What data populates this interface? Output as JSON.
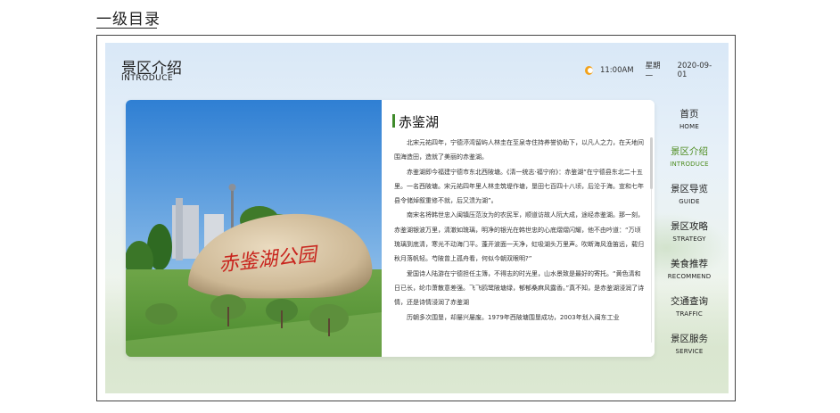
{
  "page_label": "一级目录",
  "header": {
    "title": "景区介绍",
    "subtitle": "INTRODUCE",
    "weather_icon": "sun-icon",
    "time": "11:00AM",
    "weekday": "星期一",
    "date": "2020-09-01"
  },
  "article": {
    "title": "赤鉴湖",
    "paragraphs": [
      "北宋元祐四年，宁德渟湾留屿人林圭在至泉寺住持养誉协助下，以凡人之力，在天地间围海造田，造就了美丽的赤鉴湖。",
      "赤鉴湖即今福建宁德市东北西陂塘。《清一统志·福宁府》：赤鉴湖“在宁德县东北二十五里。一名西陂塘。宋元祐四年里人林圭筑堤作塘，垦田七百四十八顷，后沦于海。宣和七年县令储焯叙重修不就，后又溃为湖”。",
      "南宋名将韩世忠入闽镇压范汝为的农民军，顺道访故人阮大成，途经赤鉴湖。那一刻，赤鉴湖银波万里，清澈如琉璃，明净的银光在韩世忠的心底熠熠闪耀，他不由吟道：“万顷琉璃到底清，寒光不动海门平。蓬开波面一天净，虹吸湖头万里声。吹断海风渔笛远，载归秋月落帆轻。芍陂曾上孤舟看，何似今朝双眼明?”",
      "爱国诗人陆游在宁德担任主簿，不得志的时光里，山水景致是最好的寄托。“黄色清和日已长，纶巾萧散意差强。飞飞鸥鹭陂塘绿，郁郁桑麻风露香。”真不知，是赤鉴湖浸润了诗情，还是诗情浸润了赤鉴湖",
      "历朝多次围垦，却屡兴屡废。1979年西陂塘围垦成功，2003年划入闽东工业"
    ]
  },
  "photo": {
    "stone_inscription": "赤鉴湖公园",
    "colors": {
      "sky": "#3d8ad6",
      "rock": "#d8c6a7",
      "grass": "#5f9a3a",
      "inscription": "#c8231c"
    }
  },
  "nav": {
    "items": [
      {
        "zh": "首页",
        "en": "HOME"
      },
      {
        "zh": "景区介绍",
        "en": "INTRODUCE"
      },
      {
        "zh": "景区导览",
        "en": "GUIDE"
      },
      {
        "zh": "景区攻略",
        "en": "STRATEGY"
      },
      {
        "zh": "美食推荐",
        "en": "RECOMMEND"
      },
      {
        "zh": "交通查询",
        "en": "TRAFFIC"
      },
      {
        "zh": "景区服务",
        "en": "SERVICE"
      }
    ],
    "active_color": "#4f8d22"
  }
}
